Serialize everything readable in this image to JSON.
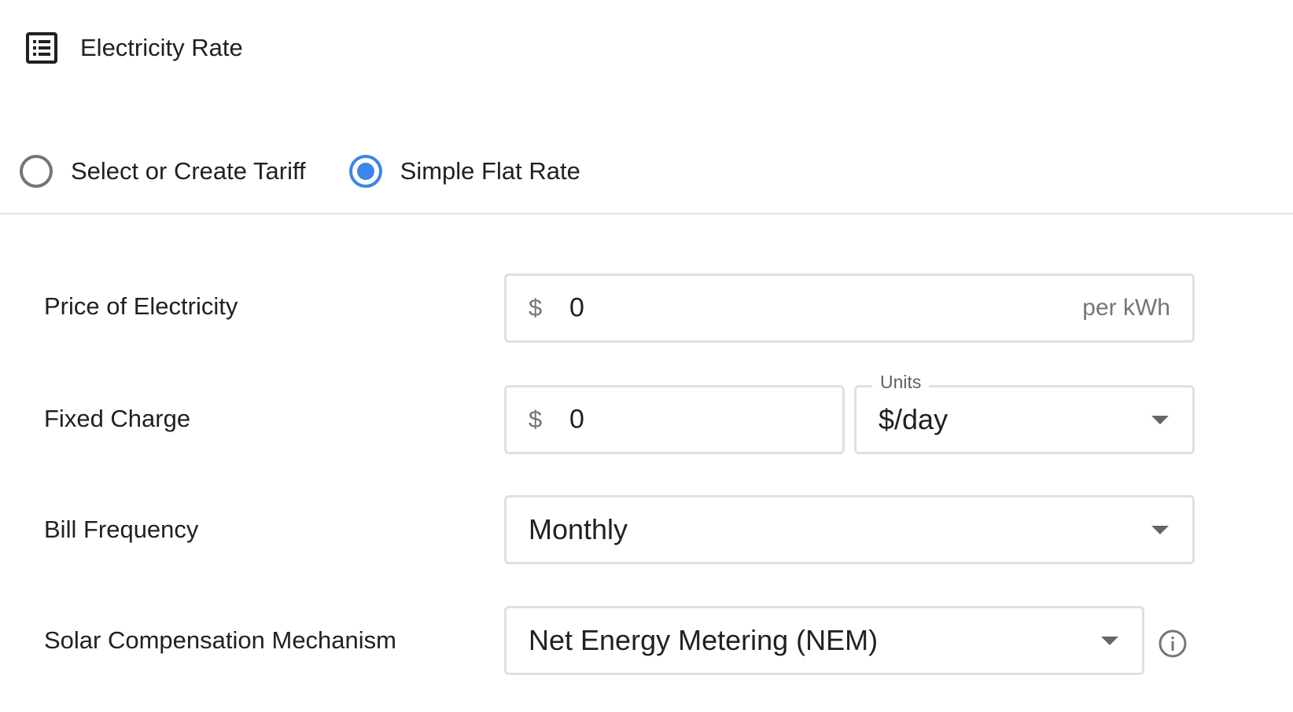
{
  "header": {
    "icon": "list-icon",
    "title": "Electricity Rate"
  },
  "rate_type": {
    "options": [
      {
        "label": "Select or Create Tariff",
        "selected": false
      },
      {
        "label": "Simple Flat Rate",
        "selected": true
      }
    ]
  },
  "colors": {
    "accent": "#3d85e8",
    "radio_unselected": "#757575",
    "border": "#e0e0e0"
  },
  "form": {
    "price": {
      "label": "Price of Electricity",
      "prefix": "$",
      "value": "0",
      "suffix": "per kWh"
    },
    "fixed_charge": {
      "label": "Fixed Charge",
      "prefix": "$",
      "value": "0",
      "units_label": "Units",
      "units_value": "$/day"
    },
    "bill_frequency": {
      "label": "Bill Frequency",
      "value": "Monthly"
    },
    "solar_compensation": {
      "label": "Solar Compensation Mechanism",
      "value": "Net Energy Metering (NEM)",
      "info_icon": "info-icon"
    }
  }
}
